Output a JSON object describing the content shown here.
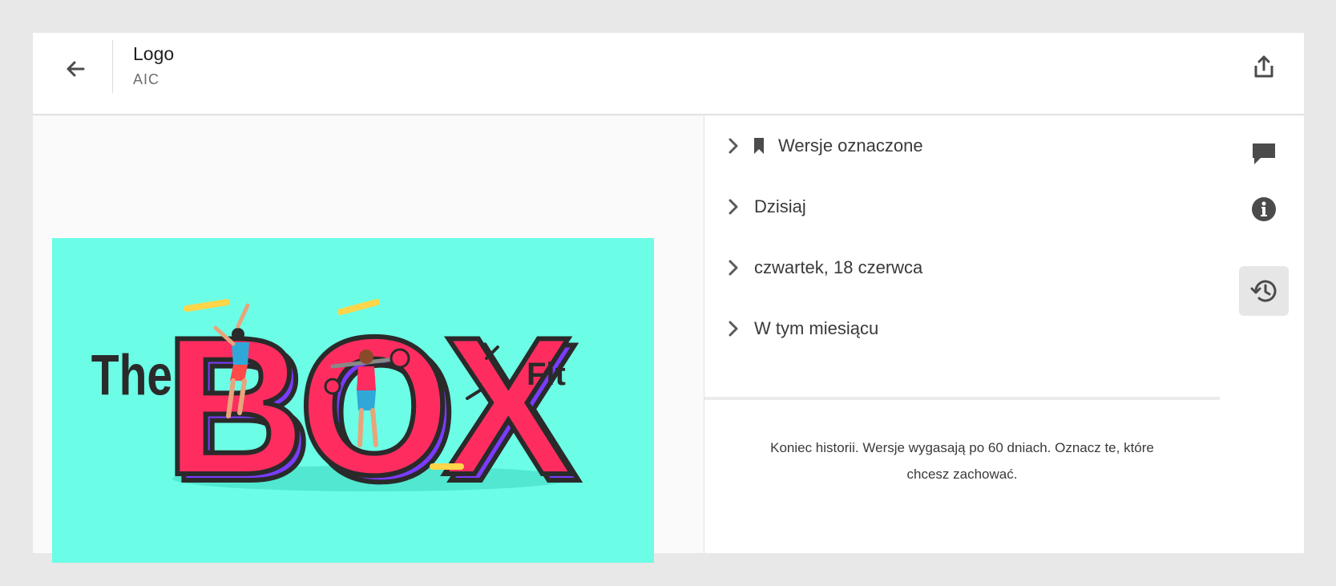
{
  "header": {
    "title": "Logo",
    "subtitle": "AIC",
    "back_icon": "arrow-left-icon",
    "share_icon": "share-upload-icon"
  },
  "preview": {
    "artwork": {
      "word_left": "The",
      "word_main": "BOX",
      "word_right": "Fit",
      "colors": {
        "background": "#6cfde6",
        "letter_fill": "#ff2d5f",
        "letter_side": "#7a3cff",
        "outline": "#2a2a2a",
        "highlight": "#ffd54a"
      }
    }
  },
  "history": {
    "groups": [
      {
        "label": "Wersje oznaczone",
        "icon": "bookmark-icon"
      },
      {
        "label": "Dzisiaj"
      },
      {
        "label": "czwartek, 18 czerwca"
      },
      {
        "label": "W tym miesiącu"
      }
    ],
    "end_note_line1": "Koniec historii. Wersje wygasają po 60 dniach. Oznacz te, które",
    "end_note_line2": "chcesz zachować."
  },
  "rail": {
    "items": [
      {
        "icon": "comment-icon",
        "active": false
      },
      {
        "icon": "info-icon",
        "active": false
      },
      {
        "icon": "history-icon",
        "active": true
      }
    ]
  },
  "colors": {
    "page_bg": "#e8e8e8",
    "panel_bg": "#ffffff",
    "preview_bg": "#fafafa",
    "active_rail_bg": "#e6e6e6",
    "icon": "#4b4b4b"
  }
}
